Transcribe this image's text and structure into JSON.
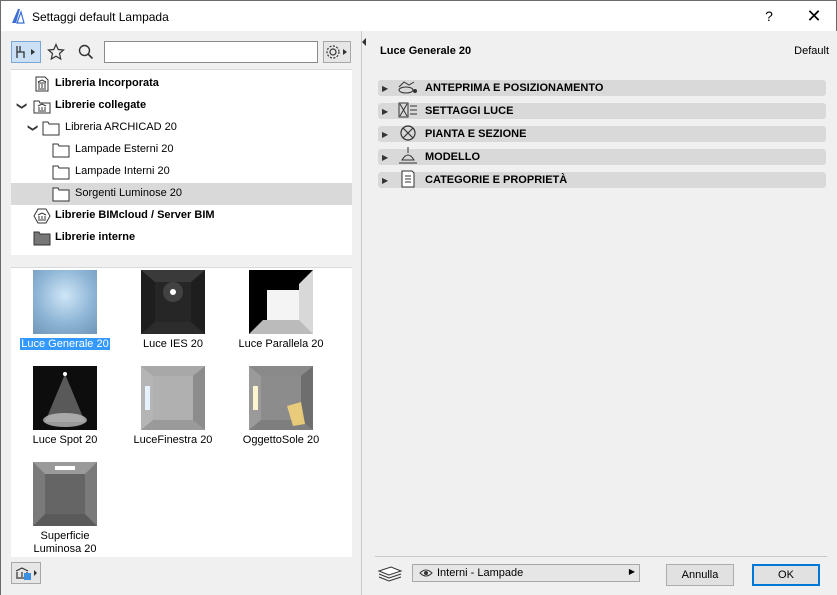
{
  "window": {
    "title": "Settaggi default Lampada",
    "help_label": "?",
    "close_label": "✕"
  },
  "toolbar": {
    "search_placeholder": ""
  },
  "tree": {
    "items": [
      {
        "label": "Libreria Incorporata",
        "bold": true
      },
      {
        "label": "Librerie collegate",
        "bold": true
      },
      {
        "label": "Libreria ARCHICAD 20",
        "bold": false
      },
      {
        "label": "Lampade Esterni 20",
        "bold": false
      },
      {
        "label": "Lampade Interni 20",
        "bold": false
      },
      {
        "label": "Sorgenti Luminose 20",
        "bold": false,
        "selected": true
      },
      {
        "label": "Librerie BIMcloud / Server BIM",
        "bold": true
      },
      {
        "label": "Librerie interne",
        "bold": true
      }
    ]
  },
  "objects": [
    {
      "label": "Luce Generale 20",
      "selected": true
    },
    {
      "label": "Luce IES 20"
    },
    {
      "label": "Luce Parallela 20"
    },
    {
      "label": "Luce Spot 20"
    },
    {
      "label": "LuceFinestra 20"
    },
    {
      "label": "OggettoSole 20"
    },
    {
      "label": "Superficie Luminosa 20"
    }
  ],
  "panel": {
    "title": "Luce Generale 20",
    "default_label": "Default",
    "sections": [
      {
        "label": "ANTEPRIMA E POSIZIONAMENTO",
        "icon": "preview-position-icon"
      },
      {
        "label": "SETTAGGI LUCE",
        "icon": "light-settings-icon"
      },
      {
        "label": "PIANTA E SEZIONE",
        "icon": "plan-section-icon"
      },
      {
        "label": "MODELLO",
        "icon": "lamp-model-icon"
      },
      {
        "label": "CATEGORIE E PROPRIETÀ",
        "icon": "categories-icon"
      }
    ]
  },
  "footer": {
    "layer": "Interni - Lampade",
    "cancel_label": "Annulla",
    "ok_label": "OK"
  },
  "colors": {
    "selection": "#3399ff",
    "tree_selected": "#d9d9d9",
    "ok_border": "#0078d7"
  }
}
